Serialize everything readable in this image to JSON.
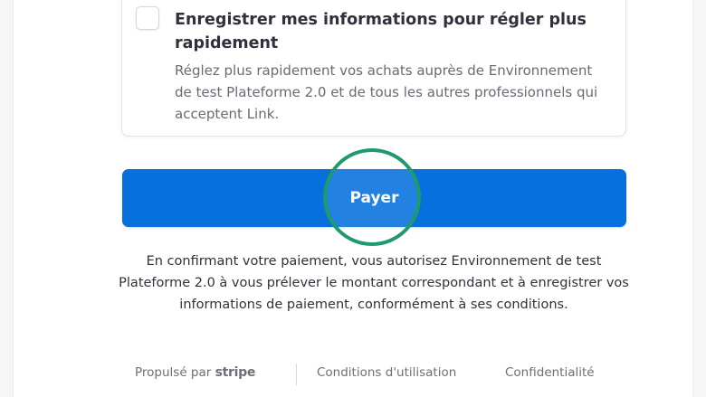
{
  "save_info": {
    "checked": false,
    "title": "Enregistrer mes informations pour régler plus rapidement",
    "description": "Réglez plus rapidement vos achats auprès de Environnement de test Plateforme 2.0 et de tous les autres professionnels qui acceptent Link."
  },
  "pay_button": {
    "label": "Payer",
    "color": "#0570de"
  },
  "mandate_text": "En confirmant votre paiement, vous autorisez Environnement de test Plateforme 2.0 à vous prélever le montant correspondant et à enregistrer vos informations de paiement, conformément à ses conditions.",
  "footer": {
    "powered_by": "Propulsé par",
    "brand": "stripe",
    "terms": "Conditions d'utilisation",
    "privacy": "Confidentialité"
  },
  "click_indicator_color": "#1f9a6a"
}
